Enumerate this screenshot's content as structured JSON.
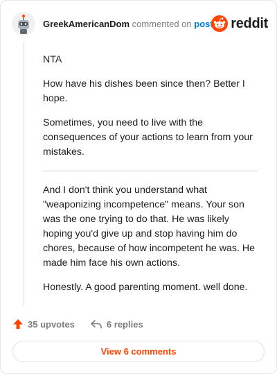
{
  "header": {
    "username": "GreekAmericanDom",
    "commented_text": "commented on",
    "post_link": "post",
    "brand": "reddit"
  },
  "comment": {
    "paragraphs_top": [
      "NTA",
      "How have his dishes been since then? Better I hope.",
      "Sometimes, you need to live with the consequences of your actions to learn from your mistakes."
    ],
    "paragraphs_bottom": [
      "And I don't think you understand what \"weaponizing incompetence\" means. Your son was the one trying to do that. He was likely hoping you'd give up and stop having him do chores, because of how incompetent he was. He made him face his own actions.",
      "Honestly. A good parenting moment. well done."
    ]
  },
  "actions": {
    "upvotes": "35 upvotes",
    "replies": "6 replies"
  },
  "view_button": "View 6 comments",
  "colors": {
    "accent": "#ff4500",
    "link": "#0079d3",
    "muted": "#7c7c7c"
  }
}
